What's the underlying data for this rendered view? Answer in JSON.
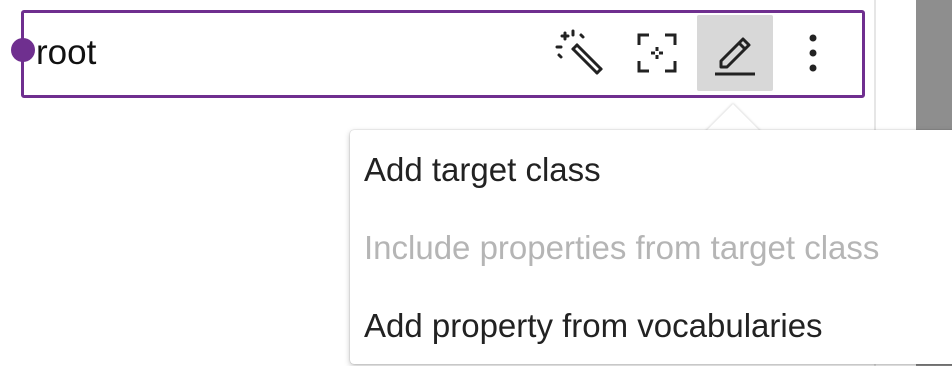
{
  "node": {
    "label": "root",
    "accent_color": "#6f2f8f"
  },
  "toolbar": {
    "tools": [
      {
        "name": "magic-wand",
        "icon": "magic-wand-icon",
        "active": false
      },
      {
        "name": "focus",
        "icon": "focus-select-icon",
        "active": false
      },
      {
        "name": "edit",
        "icon": "pencil-icon",
        "active": true
      },
      {
        "name": "more",
        "icon": "more-vert-icon",
        "active": false
      }
    ]
  },
  "menu": {
    "items": [
      {
        "label": "Add target class",
        "enabled": true
      },
      {
        "label": "Include properties from target class",
        "enabled": false
      },
      {
        "label": "Add property from vocabularies",
        "enabled": true
      }
    ]
  }
}
